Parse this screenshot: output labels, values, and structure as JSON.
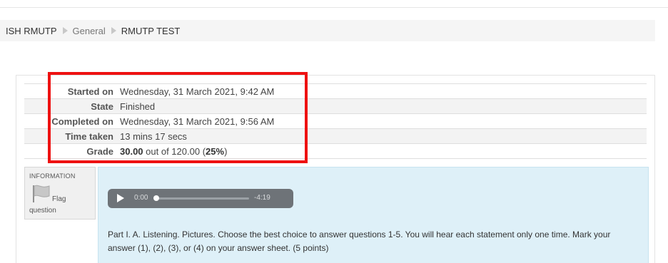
{
  "breadcrumb": {
    "items": [
      "ISH RMUTP",
      "General",
      "RMUTP TEST"
    ]
  },
  "summary": {
    "rows": [
      {
        "label": "Started on",
        "value": "Wednesday, 31 March 2021, 9:42 AM"
      },
      {
        "label": "State",
        "value": "Finished"
      },
      {
        "label": "Completed on",
        "value": "Wednesday, 31 March 2021, 9:56 AM"
      },
      {
        "label": "Time taken",
        "value": "13 mins 17 secs"
      }
    ],
    "grade": {
      "label": "Grade",
      "score": "30.00",
      "out_of_text": "out of 120.00",
      "percent": "25%"
    }
  },
  "question_info": {
    "title": "INFORMATION",
    "flag_label": "Flag",
    "flag_label2": "question"
  },
  "audio": {
    "current_time": "0:00",
    "remaining_time": "-4:19",
    "progress": 0
  },
  "question": {
    "text": "Part I. A. Listening.  Pictures. Choose the best choice to answer questions 1-5.  You will hear each statement only one time.  Mark your answer (1), (2), (3), or (4) on your answer sheet. (5 points)"
  },
  "colors": {
    "highlight": "#ee1111",
    "question_panel": "#def0f8",
    "player": "#6e7378"
  }
}
